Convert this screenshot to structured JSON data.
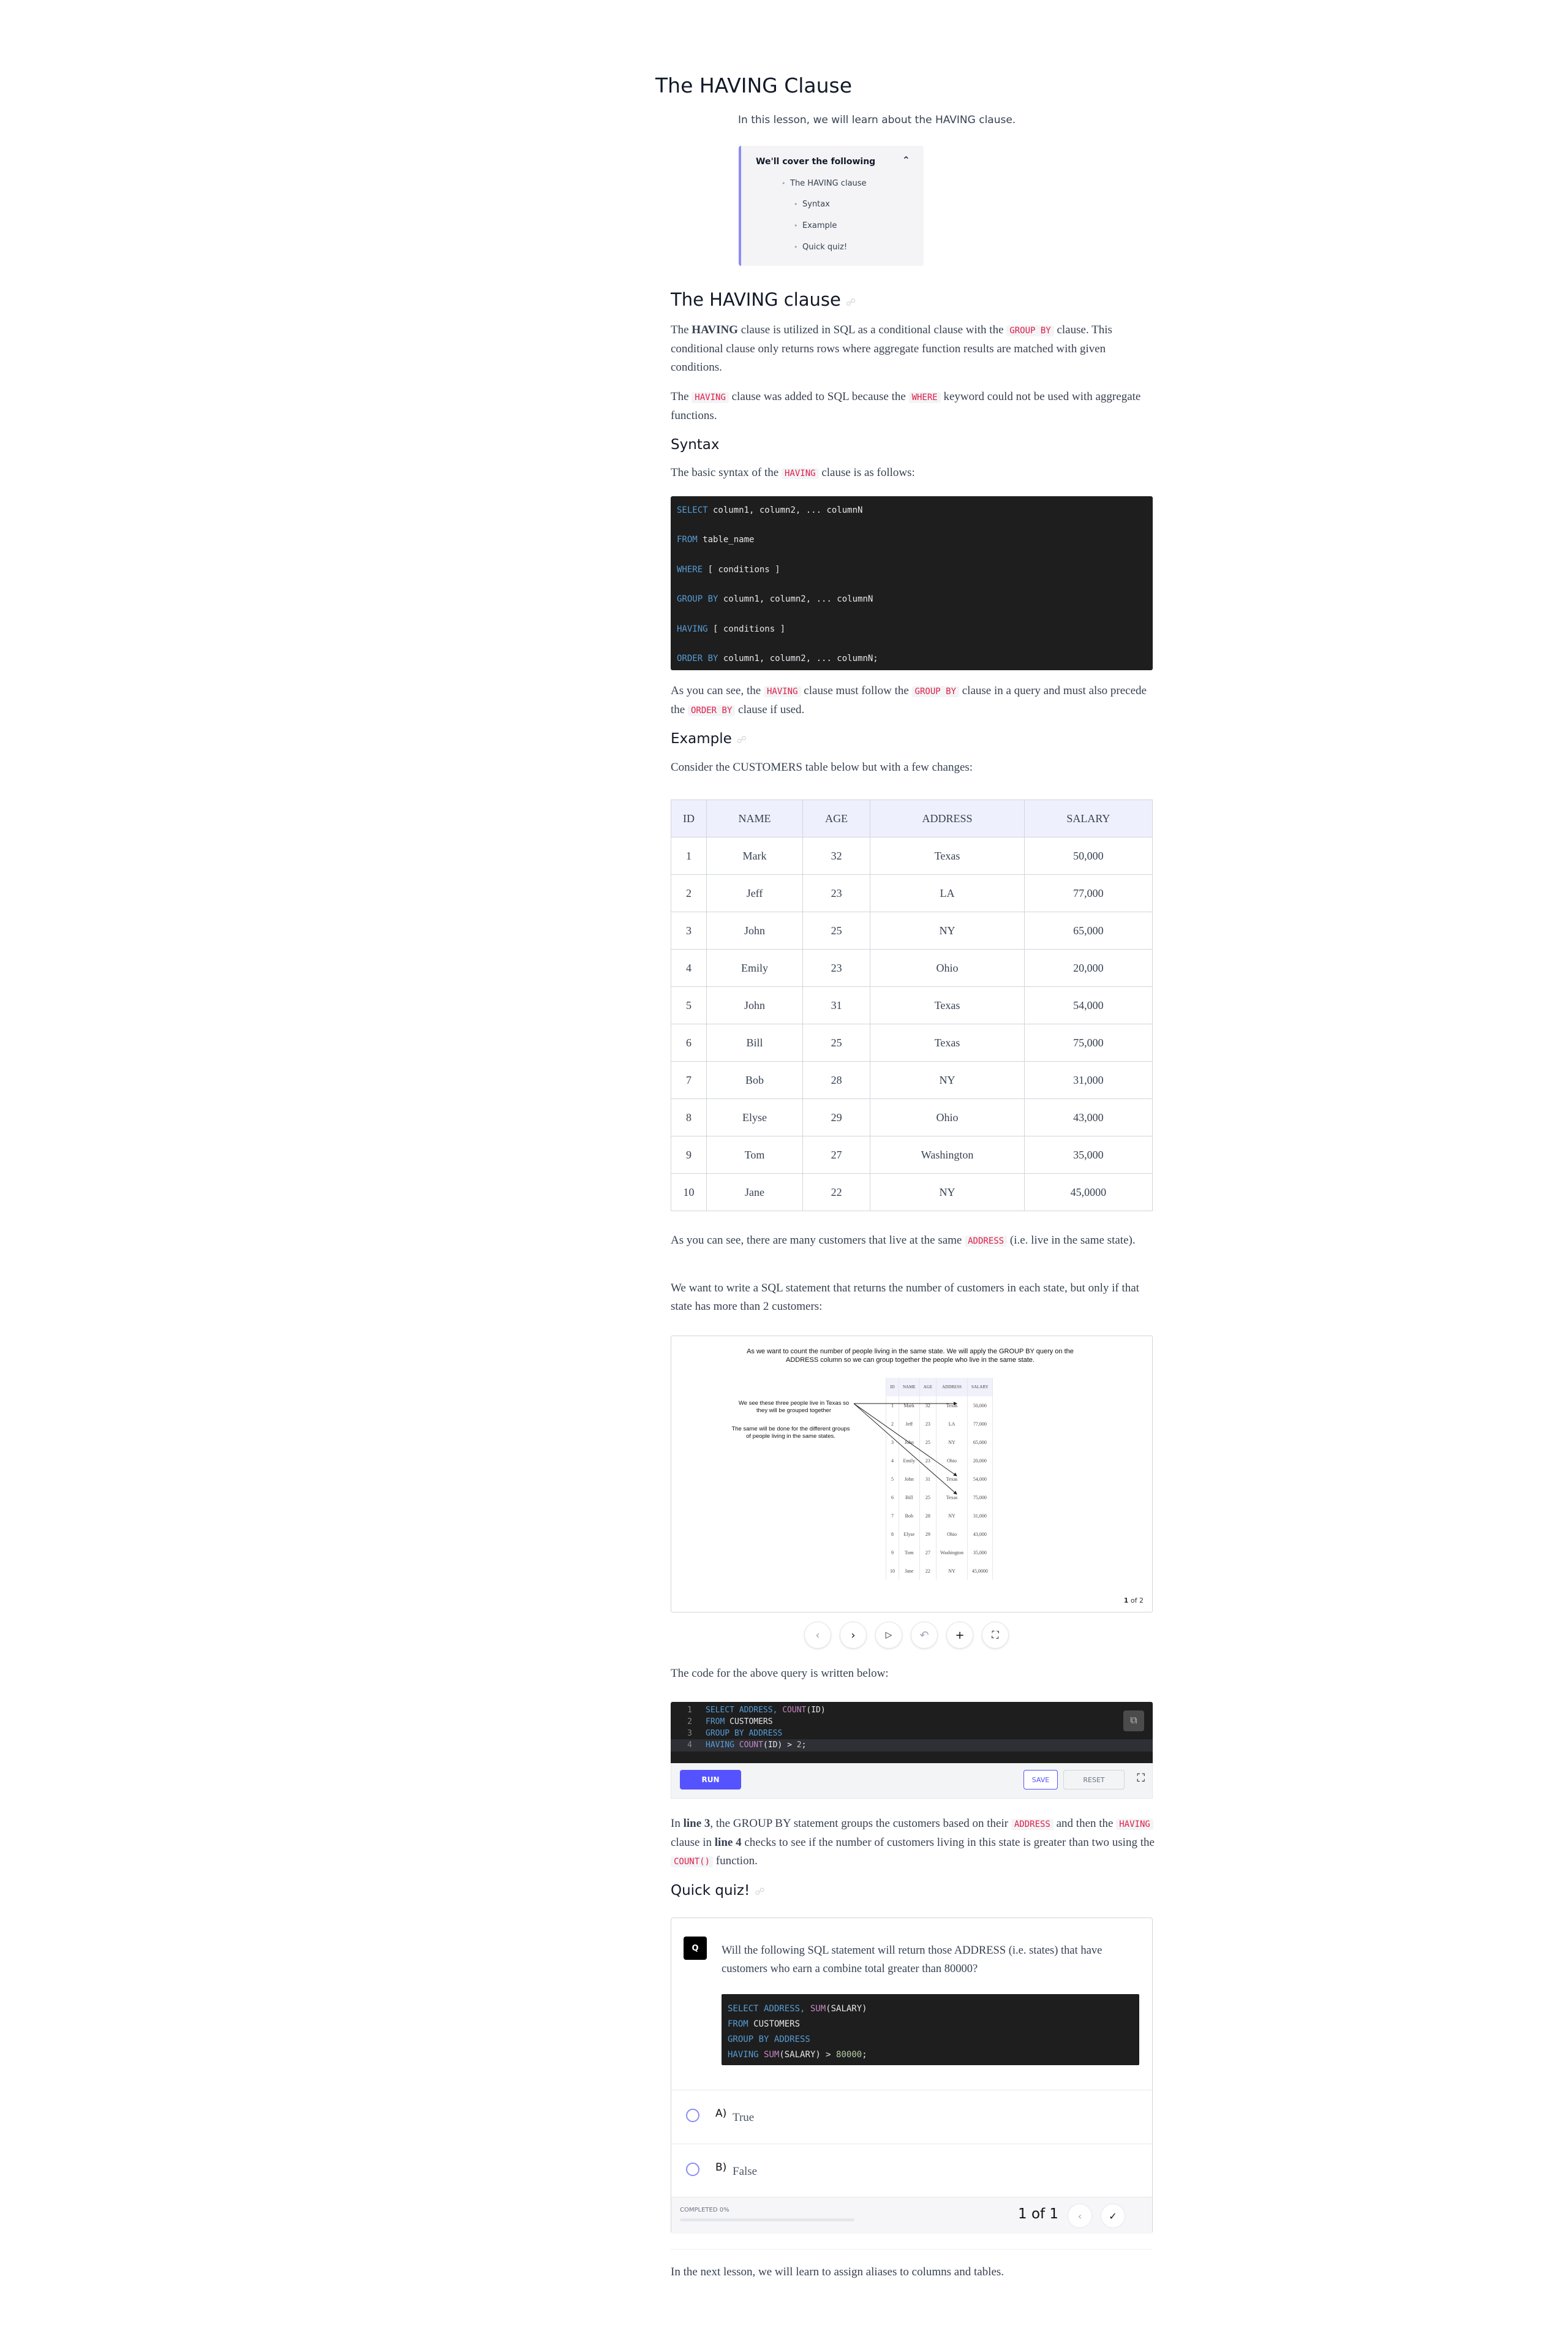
{
  "title": "The HAVING Clause",
  "intro": "In this lesson, we will learn about the HAVING clause.",
  "toc": {
    "heading": "We'll cover the following",
    "items": [
      "The HAVING clause",
      "Syntax",
      "Example",
      "Quick quiz!"
    ]
  },
  "section1": {
    "heading": "The HAVING clause",
    "p1_a": "The ",
    "p1_b": "HAVING",
    "p1_c": " clause is utilized in SQL as a conditional clause with the ",
    "p1_code": "GROUP BY",
    "p1_d": " clause. This conditional clause only returns rows where aggregate function results are matched with given conditions.",
    "p2_a": "The ",
    "p2_code1": "HAVING",
    "p2_b": " clause was added to SQL because the ",
    "p2_code2": "WHERE",
    "p2_c": " keyword could not be used with aggregate functions."
  },
  "syntax": {
    "heading": "Syntax",
    "p_a": "The basic syntax of the ",
    "p_code": "HAVING",
    "p_b": " clause is as follows:",
    "lines": [
      {
        "kw": "SELECT",
        "rest": " column1, column2, ... columnN"
      },
      {
        "kw": "FROM",
        "rest": " table_name"
      },
      {
        "kw": "WHERE",
        "rest": " [ conditions ]"
      },
      {
        "kw": "GROUP BY",
        "rest": " column1, column2, ... columnN"
      },
      {
        "kw": "HAVING",
        "rest": " [ conditions ]"
      },
      {
        "kw": "ORDER BY",
        "rest": " column1, column2, ... columnN;"
      }
    ],
    "after_a": "As you can see, the ",
    "after_code1": "HAVING",
    "after_b": " clause must follow the ",
    "after_code2": "GROUP BY",
    "after_c": " clause in a query and must also precede the ",
    "after_code3": "ORDER BY",
    "after_d": " clause if used."
  },
  "example": {
    "heading": "Example",
    "p": "Consider the CUSTOMERS table below but with a few changes:",
    "columns": [
      "ID",
      "NAME",
      "AGE",
      "ADDRESS",
      "SALARY"
    ],
    "rows": [
      [
        "1",
        "Mark",
        "32",
        "Texas",
        "50,000"
      ],
      [
        "2",
        "Jeff",
        "23",
        "LA",
        "77,000"
      ],
      [
        "3",
        "John",
        "25",
        "NY",
        "65,000"
      ],
      [
        "4",
        "Emily",
        "23",
        "Ohio",
        "20,000"
      ],
      [
        "5",
        "John",
        "31",
        "Texas",
        "54,000"
      ],
      [
        "6",
        "Bill",
        "25",
        "Texas",
        "75,000"
      ],
      [
        "7",
        "Bob",
        "28",
        "NY",
        "31,000"
      ],
      [
        "8",
        "Elyse",
        "29",
        "Ohio",
        "43,000"
      ],
      [
        "9",
        "Tom",
        "27",
        "Washington",
        "35,000"
      ],
      [
        "10",
        "Jane",
        "22",
        "NY",
        "45,0000"
      ]
    ],
    "p2_a": "As you can see, there are many customers that live at the same ",
    "p2_code": "ADDRESS",
    "p2_b": " (i.e. live in the same state).",
    "p3": "We want to write a SQL statement that returns the number of customers in each state, but only if that state has more than 2 customers:"
  },
  "slide": {
    "caption": "As we want to count the number of people living in the same state. We will apply the GROUP BY query on the ADDRESS column so we can group together the people who live in the same state.",
    "note1": "We see these three people live in Texas so they will be grouped together",
    "note2": "The same will be done for the different groups of people living in the same states.",
    "columns": [
      "ID",
      "NAME",
      "AGE",
      "ADDRESS",
      "SALARY"
    ],
    "rows": [
      [
        "1",
        "Mark",
        "32",
        "Texas",
        "50,000"
      ],
      [
        "2",
        "Jeff",
        "23",
        "LA",
        "77,000"
      ],
      [
        "3",
        "John",
        "25",
        "NY",
        "65,000"
      ],
      [
        "4",
        "Emily",
        "23",
        "Ohio",
        "20,000"
      ],
      [
        "5",
        "John",
        "31",
        "Texas",
        "54,000"
      ],
      [
        "6",
        "Bill",
        "25",
        "Texas",
        "75,000"
      ],
      [
        "7",
        "Bob",
        "28",
        "NY",
        "31,000"
      ],
      [
        "8",
        "Elyse",
        "29",
        "Ohio",
        "43,000"
      ],
      [
        "9",
        "Tom",
        "27",
        "Washington",
        "35,000"
      ],
      [
        "10",
        "Jane",
        "22",
        "NY",
        "45,0000"
      ]
    ],
    "page_current": "1",
    "page_total": "of 2"
  },
  "code_intro": "The code for the above query is written below:",
  "editor": {
    "lines": [
      {
        "n": "1",
        "parts": [
          [
            "kw",
            "SELECT ADDRESS, "
          ],
          [
            "fn",
            "COUNT"
          ],
          [
            "t",
            "(ID)"
          ]
        ]
      },
      {
        "n": "2",
        "parts": [
          [
            "kw",
            "FROM "
          ],
          [
            "t",
            "CUSTOMERS"
          ]
        ]
      },
      {
        "n": "3",
        "parts": [
          [
            "kw",
            "GROUP BY ADDRESS"
          ]
        ]
      },
      {
        "n": "4",
        "parts": [
          [
            "kw",
            "HAVING "
          ],
          [
            "fn",
            "COUNT"
          ],
          [
            "t",
            "(ID) > "
          ],
          [
            "num",
            "2"
          ],
          [
            "t",
            ";"
          ]
        ]
      }
    ],
    "run": "RUN",
    "save": "SAVE",
    "reset": "RESET"
  },
  "explain": {
    "a": "In ",
    "b": "line 3",
    "c": ", the GROUP BY statement groups the customers based on their ",
    "code1": "ADDRESS",
    "d": " and then the ",
    "code2": "HAVING",
    "e": " clause in ",
    "f": "line 4",
    "g": " checks to see if the number of customers living in this state is greater than two using the ",
    "code3": "COUNT()",
    "h": " function."
  },
  "quiz": {
    "heading": "Quick quiz!",
    "badge": "Q",
    "question": "Will the following SQL statement will return those ADDRESS (i.e. states) that have customers who earn a combine total greater than 80000?",
    "code": [
      [
        [
          "kw",
          "SELECT ADDRESS, "
        ],
        [
          "fn",
          "SUM"
        ],
        [
          "t",
          "(SALARY)"
        ]
      ],
      [
        [
          "kw",
          "FROM "
        ],
        [
          "t",
          "CUSTOMERS"
        ]
      ],
      [
        [
          "kw",
          "GROUP BY ADDRESS"
        ]
      ],
      [
        [
          "kw",
          "HAVING "
        ],
        [
          "fn",
          "SUM"
        ],
        [
          "t",
          "(SALARY) > "
        ],
        [
          "num",
          "80000"
        ],
        [
          "t",
          ";"
        ]
      ]
    ],
    "options": [
      {
        "key": "A)",
        "value": "True"
      },
      {
        "key": "B)",
        "value": "False"
      }
    ],
    "completed": "COMPLETED 0%",
    "progress": 0,
    "pager": "1 of 1"
  },
  "next_lesson": "In the next lesson, we will learn to assign aliases to columns and tables."
}
